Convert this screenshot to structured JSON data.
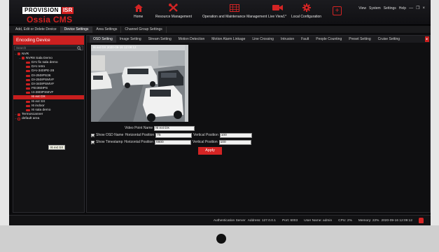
{
  "app": {
    "brand": "PROVISION",
    "brand_badge": "ISR",
    "product": "Ossia CMS"
  },
  "nav": [
    {
      "label": "Home",
      "icon": "home-icon"
    },
    {
      "label": "Resource Management",
      "icon": "tools-icon"
    },
    {
      "label": "Operation and Maintenance Management",
      "icon": "grid-icon"
    },
    {
      "label": "Live View1*",
      "icon": "camera-icon"
    },
    {
      "label": "Local Configuration",
      "icon": "gear-icon"
    },
    {
      "label": "",
      "icon": "add-icon"
    }
  ],
  "top_right": {
    "view": "View",
    "system": "System",
    "settings": "Settings",
    "help": "Help",
    "minimize": "—",
    "restore": "❐",
    "close": "×"
  },
  "tabs_primary": [
    {
      "label": "Add, Edit or Delete Device",
      "active": false
    },
    {
      "label": "Device Settings",
      "active": true
    },
    {
      "label": "Area Settings",
      "active": false
    },
    {
      "label": "Channel Group Settings",
      "active": false
    }
  ],
  "sidebar": {
    "header": "Encoding Device",
    "search_placeholder": "Search",
    "tree": [
      {
        "label": "NVR",
        "level": 0,
        "type": "root"
      },
      {
        "label": "NVR8 Sala Demo",
        "level": 1,
        "type": "nvr"
      },
      {
        "label": "DAI fix sala demo",
        "level": 2,
        "type": "cam"
      },
      {
        "label": "DAI retro",
        "level": 2,
        "type": "cam"
      },
      {
        "label": "DAI-340IPE-28",
        "level": 2,
        "type": "cam"
      },
      {
        "label": "DI-250IPS36",
        "level": 2,
        "type": "cam"
      },
      {
        "label": "DI-250IPSMVF",
        "level": 2,
        "type": "cam"
      },
      {
        "label": "DI-340IPSMVF",
        "level": 2,
        "type": "cam"
      },
      {
        "label": "FEI360IPS",
        "level": 2,
        "type": "cam"
      },
      {
        "label": "I4-280IPSMVF",
        "level": 2,
        "type": "cam"
      },
      {
        "label": "I6 ext DX",
        "level": 2,
        "type": "cam",
        "selected": true
      },
      {
        "label": "I6 ext SX",
        "level": 2,
        "type": "cam"
      },
      {
        "label": "I6 indoor",
        "level": 2,
        "type": "cam"
      },
      {
        "label": "I6 sala demo",
        "level": 2,
        "type": "cam"
      },
      {
        "label": "Termoscanner",
        "level": 0,
        "type": "group"
      },
      {
        "label": "default area",
        "level": 0,
        "type": "area"
      }
    ],
    "tooltip": "I6 ext SX"
  },
  "tabs_secondary": [
    {
      "label": "OSD Setting",
      "active": true
    },
    {
      "label": "Image Setting",
      "active": false
    },
    {
      "label": "Stream Setting",
      "active": false
    },
    {
      "label": "Motion Detection",
      "active": false
    },
    {
      "label": "Motion Alarm Linkage",
      "active": false
    },
    {
      "label": "Line Crossing",
      "active": false
    },
    {
      "label": "Intrusion",
      "active": false
    },
    {
      "label": "Fault",
      "active": false
    },
    {
      "label": "People Counting",
      "active": false
    },
    {
      "label": "Preset Setting",
      "active": false
    },
    {
      "label": "Cruise Setting",
      "active": false
    }
  ],
  "osd": {
    "video_overlay": "I6 ext DX  2020-09-16 12:09:12",
    "video_point_name_label": "Video Point Name",
    "video_point_name_value": "I6 ext DX",
    "show_osd_name_label": "Show OSD Name",
    "show_osd_name_checked": true,
    "show_timestamp_label": "Show Timestamp",
    "show_timestamp_checked": true,
    "horizontal_position_label": "Horizontal Position",
    "vertical_position_label": "Vertical Position",
    "osd_h": "75",
    "osd_v": "100",
    "ts_h": "6600",
    "ts_v": "100",
    "apply_label": "Apply"
  },
  "status": {
    "server": "Authentication Server",
    "address": "Address: 127.0.0.1",
    "port": "Port: 6003",
    "user": "User Name: admin",
    "cpu": "CPU: 2%",
    "memory": "Memory: 22%",
    "datetime": "2020-09-16 12:09:12"
  },
  "colors": {
    "accent": "#d42424",
    "background": "#0f0f11"
  }
}
